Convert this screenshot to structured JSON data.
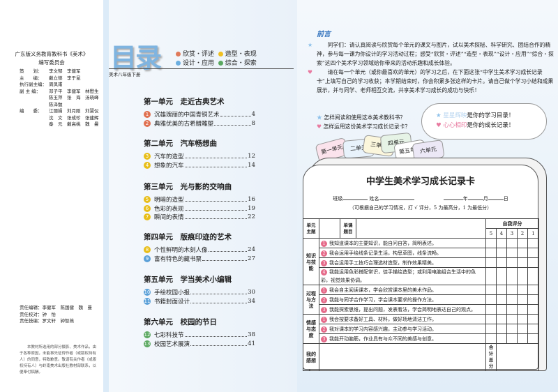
{
  "credits": {
    "title": "广东版义务教育教科书《美术》",
    "subtitle": "编写委员会",
    "rows": [
      {
        "role": "策　　划：",
        "names": "李文郁　李健军"
      },
      {
        "role": "主　　编：",
        "names": "戴立德　李于昆"
      },
      {
        "role": "执行副主编：",
        "names": "周凤甫"
      },
      {
        "role": "副 主 编：",
        "names": "邓子平　李健军　林懋生"
      },
      {
        "role": "",
        "names": "陈玉萍　张　海　汤晓峰"
      },
      {
        "role": "",
        "names": "陈泽勉"
      },
      {
        "role": "编　　委：",
        "names": "江丽娟　刘月刚　刘慧仪"
      },
      {
        "role": "",
        "names": "沈　文　张成珍　张建辉"
      },
      {
        "role": "",
        "names": "秦　元　戴高桃　魏　曼"
      }
    ],
    "editors": [
      "责任编辑：李健军　陈国健　魏　曼",
      "责任校对：钟　怡",
      "责任技编：罗文轩　钟智燕"
    ],
    "notice": "本教材所选用的部分摄影、美术作品，由于各种原因，未能事先征得作者（或版权持有人）的同意，特致歉意。敬请有关作者（或版权持有人）与岭南美术出版社教材部联系，以便奉付稿酬。"
  },
  "toc": {
    "title": "目录",
    "grade": "美术八年级下册",
    "legend": [
      {
        "label": "欣赏・评述",
        "color": "#e07a5a"
      },
      {
        "label": "造型・表现",
        "color": "#f0c020"
      },
      {
        "label": "设计・应用",
        "color": "#6aaee0"
      },
      {
        "label": "综合・探索",
        "color": "#5aa860"
      }
    ],
    "units": [
      {
        "title": "第一单元　走近古典艺术",
        "items": [
          {
            "n": "1",
            "label": "沉雄瑰丽的中国青铜艺术",
            "page": "4",
            "color": "#e07050"
          },
          {
            "n": "2",
            "label": "典雅优美的古希腊雕塑",
            "page": "8",
            "color": "#e07050"
          }
        ]
      },
      {
        "title": "第二单元　汽车畅想曲",
        "items": [
          {
            "n": "3",
            "label": "汽车的造型",
            "page": "12",
            "color": "#e8be18"
          },
          {
            "n": "4",
            "label": "想象的汽车",
            "page": "14",
            "color": "#e8be18"
          }
        ]
      },
      {
        "title": "第三单元　光与影的交响曲",
        "items": [
          {
            "n": "5",
            "label": "明暗的造型",
            "page": "16",
            "color": "#e8be18"
          },
          {
            "n": "6",
            "label": "色彩的表现",
            "page": "19",
            "color": "#e8be18"
          },
          {
            "n": "7",
            "label": "瞬间的表情",
            "page": "22",
            "color": "#e8be18"
          }
        ]
      },
      {
        "title": "第四单元　版痕印迹的艺术",
        "items": [
          {
            "n": "8",
            "label": "个性鲜明的木刻人像",
            "page": "24",
            "color": "#e8be18"
          },
          {
            "n": "9",
            "label": "富有特色的藏书票",
            "page": "27",
            "color": "#5aa0d8"
          }
        ]
      },
      {
        "title": "第五单元　学当美术小编辑",
        "items": [
          {
            "n": "10",
            "label": "手绘校园小报",
            "page": "30",
            "color": "#5aa0d8"
          },
          {
            "n": "11",
            "label": "书籍封面设计",
            "page": "34",
            "color": "#5aa0d8"
          }
        ]
      },
      {
        "title": "第六单元　校园的节日",
        "items": [
          {
            "n": "12",
            "label": "七彩科技节",
            "page": "38",
            "color": "#5aa860"
          },
          {
            "n": "13",
            "label": "校园艺术展演",
            "page": "41",
            "color": "#5aa860"
          }
        ]
      }
    ]
  },
  "preface": {
    "heading": "前言",
    "p1": "同学们：请认真阅读与欣赏每个单元的课文与图片，试以美术探秘、科学研究、团结合作的精神，参与每一课为你设计的学习活动过程；感受“欣赏・评述”“造型・表现”“设计・应用”“综合・探索”这四个美术学习领域给你带来的活动乐趣和成长体验。",
    "p2": "请在每一个单元（或你最喜欢的单元）的学习之后，在下面这张“中学生美术学习成长记录卡”上填写自己的学习收获；本学期结束时，你会积累多张这样的卡片。请自己做个学习小结和成果展示，并与同学、老师相互交流，共享美术学习成长的成功与快乐！",
    "q1": "怎样阅读和使用这本美术教科书？",
    "q2": "怎样运用这份美术学习成长记录卡？",
    "bubble1a": "星星辉映",
    "bubble1b": "是你的学习目录！",
    "bubble2a": "心心相印",
    "bubble2b": "是你的成长记录！",
    "tabs": [
      "第一单元",
      "二单元",
      "三单元",
      "四单元",
      "第五单元",
      "六单元"
    ]
  },
  "card": {
    "title": "中学生美术学习成长记录卡",
    "class_label": "班级",
    "name_label": "姓名",
    "year": "年",
    "month": "月",
    "day": "日",
    "hint": "（可根据自己的学习情况，打  √  评分，5 为最高分，1 为最低分）",
    "h_unit": "单元主题",
    "h_lesson": "单课题目",
    "h_self": "自我评分",
    "scores": [
      "5",
      "4",
      "3",
      "2",
      "1"
    ],
    "groups": [
      {
        "name": "知识与技能",
        "rows": [
          "我知道课本的主要知识，能自问自答，简明表述。",
          "我会运用手绘线条记录生活，构思草图，线条流畅。",
          "我会运用手工技巧合理选材造型，制作效果精美。",
          "我能运用色彩搭配常识，徒手描绘造型；或利用电脑组合生活中的色彩，视觉效果协调。"
        ]
      },
      {
        "name": "过程与方法",
        "rows": [
          "我会自主阅读课本，学会欣赏课本里的美术作品。",
          "我能与同学合作学习，学会课本要求的操作方法。",
          "我能探索思维，提出问题，发表看法，学会简明地表达自己的观点。"
        ]
      },
      {
        "name": "情感与态度",
        "rows": [
          "我会按要求备好工具、材料，做好场地清洁工作。",
          "我对课本的学习内容感兴趣，主动参与学习活动。",
          "我能开动脑筋，作业具有与众不同的美感与创意。"
        ]
      }
    ],
    "feel": "我的感想",
    "total": "合计总分"
  }
}
